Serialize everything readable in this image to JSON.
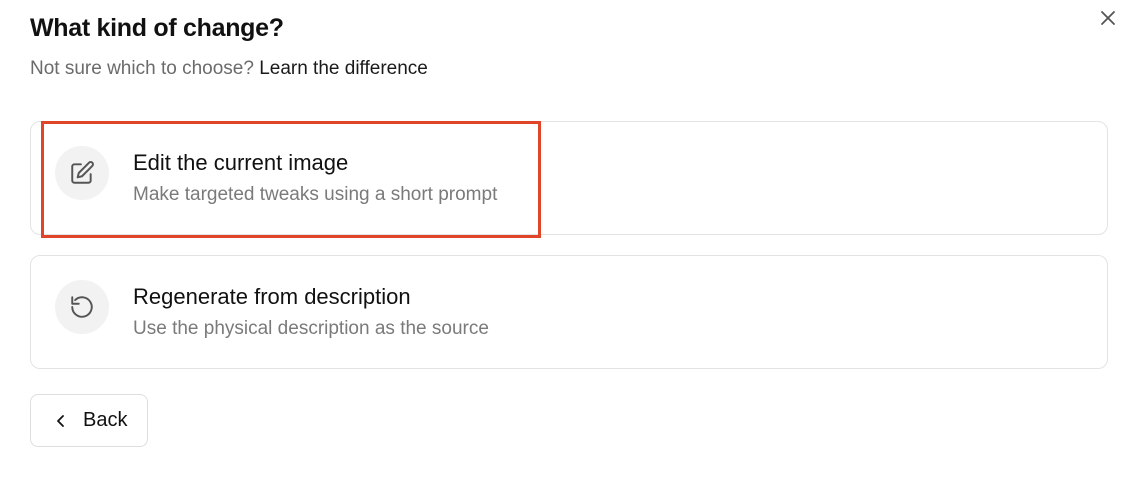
{
  "dialog": {
    "title": "What kind of change?",
    "subtitle_prefix": "Not sure which to choose? ",
    "subtitle_link": "Learn the difference",
    "close_icon": "close-icon"
  },
  "options": [
    {
      "title": "Edit the current image",
      "description": "Make targeted tweaks using a short prompt",
      "icon": "edit-icon",
      "highlighted": true
    },
    {
      "title": "Regenerate from description",
      "description": "Use the physical description as the source",
      "icon": "rotate-ccw-icon",
      "highlighted": false
    }
  ],
  "footer": {
    "back_label": "Back",
    "back_icon": "chevron-left-icon"
  },
  "colors": {
    "highlight": "#e0452a",
    "card_border": "#e3e3e3",
    "icon_bg": "#f2f2f2",
    "muted_text": "#7a7a7a"
  }
}
